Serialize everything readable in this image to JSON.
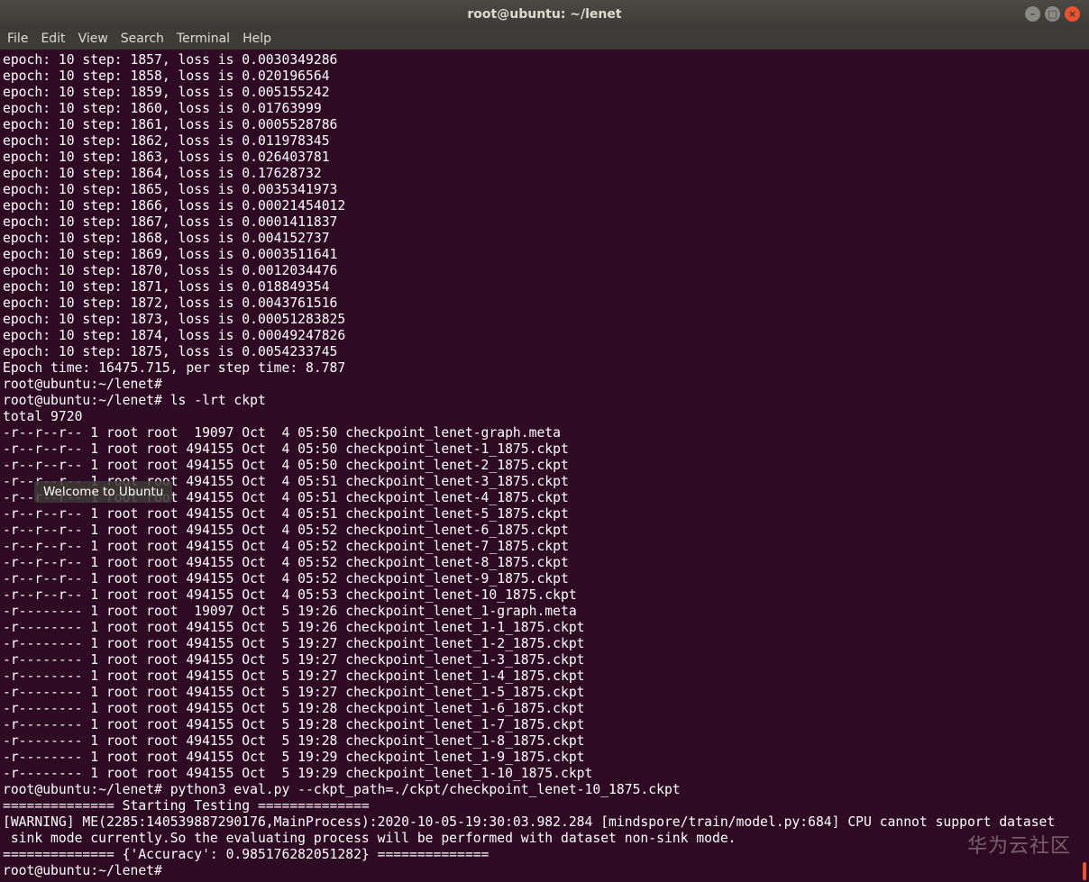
{
  "window": {
    "title": "root@ubuntu: ~/lenet"
  },
  "menu": [
    "File",
    "Edit",
    "View",
    "Search",
    "Terminal",
    "Help"
  ],
  "terminal": {
    "lines": [
      "epoch: 10 step: 1857, loss is 0.0030349286",
      "epoch: 10 step: 1858, loss is 0.020196564",
      "epoch: 10 step: 1859, loss is 0.005155242",
      "epoch: 10 step: 1860, loss is 0.01763999",
      "epoch: 10 step: 1861, loss is 0.0005528786",
      "epoch: 10 step: 1862, loss is 0.011978345",
      "epoch: 10 step: 1863, loss is 0.026403781",
      "epoch: 10 step: 1864, loss is 0.17628732",
      "epoch: 10 step: 1865, loss is 0.0035341973",
      "epoch: 10 step: 1866, loss is 0.00021454012",
      "epoch: 10 step: 1867, loss is 0.0001411837",
      "epoch: 10 step: 1868, loss is 0.004152737",
      "epoch: 10 step: 1869, loss is 0.0003511641",
      "epoch: 10 step: 1870, loss is 0.0012034476",
      "epoch: 10 step: 1871, loss is 0.018849354",
      "epoch: 10 step: 1872, loss is 0.0043761516",
      "epoch: 10 step: 1873, loss is 0.00051283825",
      "epoch: 10 step: 1874, loss is 0.00049247826",
      "epoch: 10 step: 1875, loss is 0.0054233745",
      "Epoch time: 16475.715, per step time: 8.787",
      "root@ubuntu:~/lenet#",
      "root@ubuntu:~/lenet# ls -lrt ckpt",
      "total 9720",
      "-r--r--r-- 1 root root  19097 Oct  4 05:50 checkpoint_lenet-graph.meta",
      "-r--r--r-- 1 root root 494155 Oct  4 05:50 checkpoint_lenet-1_1875.ckpt",
      "-r--r--r-- 1 root root 494155 Oct  4 05:50 checkpoint_lenet-2_1875.ckpt",
      "-r--r--r-- 1 root root 494155 Oct  4 05:51 checkpoint_lenet-3_1875.ckpt",
      "-r--r--r-- 1 root root 494155 Oct  4 05:51 checkpoint_lenet-4_1875.ckpt",
      "-r--r--r-- 1 root root 494155 Oct  4 05:51 checkpoint_lenet-5_1875.ckpt",
      "-r--r--r-- 1 root root 494155 Oct  4 05:52 checkpoint_lenet-6_1875.ckpt",
      "-r--r--r-- 1 root root 494155 Oct  4 05:52 checkpoint_lenet-7_1875.ckpt",
      "-r--r--r-- 1 root root 494155 Oct  4 05:52 checkpoint_lenet-8_1875.ckpt",
      "-r--r--r-- 1 root root 494155 Oct  4 05:52 checkpoint_lenet-9_1875.ckpt",
      "-r--r--r-- 1 root root 494155 Oct  4 05:53 checkpoint_lenet-10_1875.ckpt",
      "-r-------- 1 root root  19097 Oct  5 19:26 checkpoint_lenet_1-graph.meta",
      "-r-------- 1 root root 494155 Oct  5 19:26 checkpoint_lenet_1-1_1875.ckpt",
      "-r-------- 1 root root 494155 Oct  5 19:27 checkpoint_lenet_1-2_1875.ckpt",
      "-r-------- 1 root root 494155 Oct  5 19:27 checkpoint_lenet_1-3_1875.ckpt",
      "-r-------- 1 root root 494155 Oct  5 19:27 checkpoint_lenet_1-4_1875.ckpt",
      "-r-------- 1 root root 494155 Oct  5 19:27 checkpoint_lenet_1-5_1875.ckpt",
      "-r-------- 1 root root 494155 Oct  5 19:28 checkpoint_lenet_1-6_1875.ckpt",
      "-r-------- 1 root root 494155 Oct  5 19:28 checkpoint_lenet_1-7_1875.ckpt",
      "-r-------- 1 root root 494155 Oct  5 19:28 checkpoint_lenet_1-8_1875.ckpt",
      "-r-------- 1 root root 494155 Oct  5 19:29 checkpoint_lenet_1-9_1875.ckpt",
      "-r-------- 1 root root 494155 Oct  5 19:29 checkpoint_lenet_1-10_1875.ckpt",
      "root@ubuntu:~/lenet# python3 eval.py --ckpt_path=./ckpt/checkpoint_lenet-10_1875.ckpt",
      "============== Starting Testing ==============",
      "[WARNING] ME(2285:140539887290176,MainProcess):2020-10-05-19:30:03.982.284 [mindspore/train/model.py:684] CPU cannot support dataset",
      " sink mode currently.So the evaluating process will be performed with dataset non-sink mode.",
      "============== {'Accuracy': 0.985176282051282} ==============",
      "root@ubuntu:~/lenet#"
    ]
  },
  "tooltip": "Welcome to Ubuntu",
  "watermark": "华为云社区",
  "colors": {
    "terminal_bg": "#2f0a24",
    "accent": "#e9542f"
  }
}
